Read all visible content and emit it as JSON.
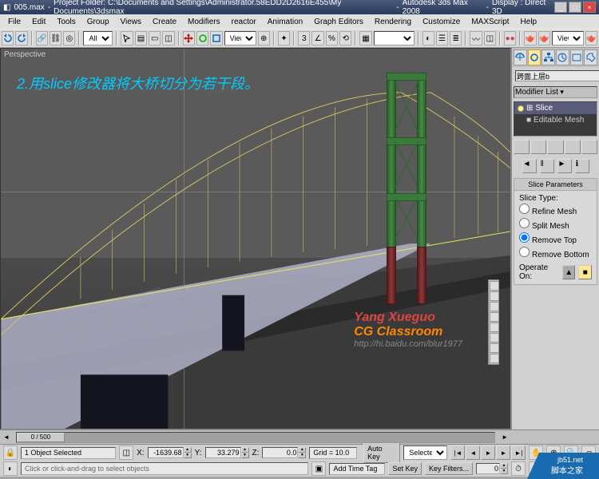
{
  "title": {
    "file": "005.max",
    "project": "Project Folder: C:\\Documents and Settings\\Administrator.58EDD2D2616E455\\My Documents\\3dsmax",
    "app": "Autodesk 3ds Max 2008",
    "display": "Display : Direct 3D"
  },
  "menu": [
    "File",
    "Edit",
    "Tools",
    "Group",
    "Views",
    "Create",
    "Modifiers",
    "reactor",
    "Animation",
    "Graph Editors",
    "Rendering",
    "Customize",
    "MAXScript",
    "Help"
  ],
  "toolbar": {
    "combo1": "All",
    "combo2": "View",
    "combo3": "View"
  },
  "viewport": {
    "label": "Perspective",
    "tutorial": "2.用slice修改器将大桥切分为若干段。"
  },
  "watermark": {
    "l1": "Yang Xueguo",
    "l2": "CG Classroom",
    "l3": "http://hi.baidu.com/blur1977",
    "site_url": "jb51.net",
    "site_name": "脚本之家"
  },
  "panel": {
    "name": "跨面上层b",
    "modlist": "Modifier List",
    "stack": [
      "Slice",
      "Editable Mesh"
    ]
  },
  "slice": {
    "title": "Slice Parameters",
    "type_label": "Slice Type:",
    "opts": [
      "Refine Mesh",
      "Split Mesh",
      "Remove Top",
      "Remove Bottom"
    ],
    "selected": "Remove Top",
    "operate": "Operate On:"
  },
  "timeline": {
    "thumb": "0 / 500",
    "start": "0",
    "end": "500"
  },
  "status": {
    "selected": "1 Object Selected",
    "x": "-1639.68",
    "y": "33.279",
    "z": "0.0",
    "grid": "Grid = 10.0",
    "addtag": "Add Time Tag",
    "autokey": "Auto Key",
    "setkey": "Set Key",
    "keyfilters": "Key Filters...",
    "selfilter": "Selected",
    "prompt": "Click or click-and-drag to select objects",
    "frame": "0"
  }
}
